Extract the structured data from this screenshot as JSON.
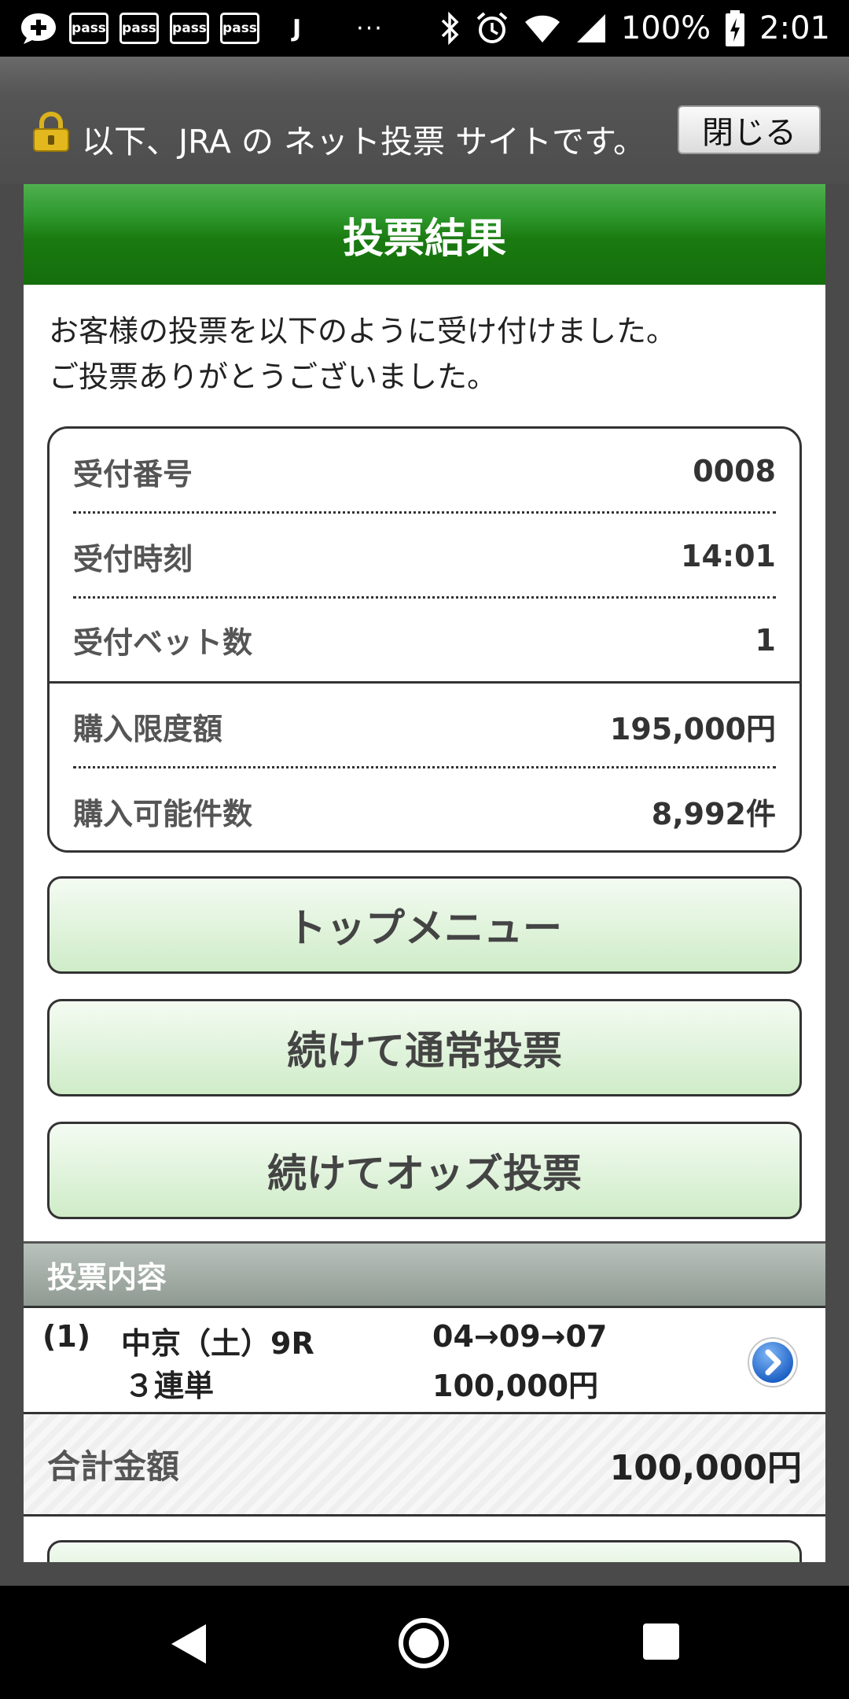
{
  "status_bar": {
    "pass_badges": [
      "pass",
      "pass",
      "pass",
      "pass"
    ],
    "j_label": "J",
    "dots": "···",
    "battery": "100%",
    "time": "2:01"
  },
  "banner": {
    "text": "以下、JRA の ネット投票 サイトです。",
    "close_label": "閉じる"
  },
  "header": {
    "title": "投票結果"
  },
  "intro": {
    "line1": "お客様の投票を以下のように受け付けました。",
    "line2": "ご投票ありがとうございました。"
  },
  "info": {
    "rows": [
      {
        "label": "受付番号",
        "value": "0008"
      },
      {
        "label": "受付時刻",
        "value": "14:01"
      },
      {
        "label": "受付ベット数",
        "value": "1"
      },
      {
        "label": "購入限度額",
        "value": "195,000円"
      },
      {
        "label": "購入可能件数",
        "value": "8,992件"
      }
    ]
  },
  "buttons": {
    "top_menu": "トップメニュー",
    "continue_normal": "続けて通常投票",
    "continue_odds": "続けてオッズ投票"
  },
  "bets": {
    "section_title": "投票内容",
    "items": [
      {
        "no": "(1)",
        "venue": "中京（土）9R",
        "type": "３連単",
        "combo": "04→09→07",
        "amount": "100,000円"
      }
    ]
  },
  "total": {
    "label": "合計金額",
    "value": "100,000円"
  },
  "colors": {
    "header_green": "#1a7a10",
    "button_green": "#cfecc8",
    "arrow_blue": "#1e6fd0"
  }
}
